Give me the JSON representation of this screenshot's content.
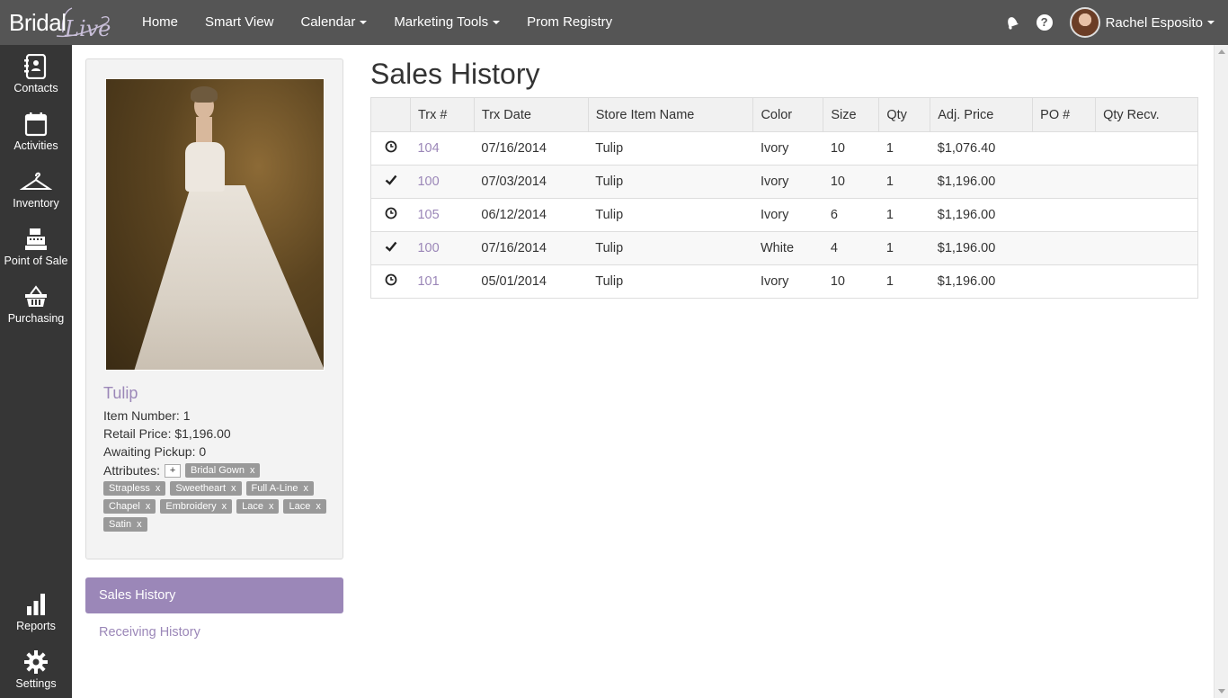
{
  "brand": {
    "part1": "Bridal",
    "part2": "Live"
  },
  "nav": {
    "items": [
      {
        "label": "Home",
        "dropdown": false
      },
      {
        "label": "Smart View",
        "dropdown": false
      },
      {
        "label": "Calendar",
        "dropdown": true
      },
      {
        "label": "Marketing Tools",
        "dropdown": true
      },
      {
        "label": "Prom Registry",
        "dropdown": false
      }
    ],
    "help": "?",
    "user_name": "Rachel Esposito"
  },
  "sidebar": {
    "top_items": [
      {
        "label": "Contacts",
        "icon": "contacts-icon"
      },
      {
        "label": "Activities",
        "icon": "calendar-icon"
      },
      {
        "label": "Inventory",
        "icon": "hanger-icon"
      },
      {
        "label": "Point of Sale",
        "icon": "register-icon"
      },
      {
        "label": "Purchasing",
        "icon": "basket-icon"
      }
    ],
    "bottom_items": [
      {
        "label": "Reports",
        "icon": "bar-chart-icon"
      },
      {
        "label": "Settings",
        "icon": "gear-icon"
      }
    ]
  },
  "product": {
    "name": "Tulip",
    "item_number": "Item Number: 1",
    "retail_price": "Retail Price: $1,196.00",
    "awaiting_pickup": "Awaiting Pickup: 0",
    "attributes_label": "Attributes:",
    "add_attribute": "+",
    "remove_glyph": "x",
    "attributes": [
      "Bridal Gown",
      "Strapless",
      "Sweetheart",
      "Full A-Line",
      "Chapel",
      "Embroidery",
      "Lace",
      "Lace",
      "Satin"
    ]
  },
  "tabs": {
    "active": "Sales History",
    "other": "Receiving History"
  },
  "main": {
    "title": "Sales History",
    "columns": [
      "",
      "Trx #",
      "Trx Date",
      "Store Item Name",
      "Color",
      "Size",
      "Qty",
      "Adj. Price",
      "PO #",
      "Qty Recv."
    ],
    "rows": [
      {
        "status": "pending",
        "trx": "104",
        "date": "07/16/2014",
        "item": "Tulip",
        "color": "Ivory",
        "size": "10",
        "qty": "1",
        "price": "$1,076.40",
        "po": "",
        "qty_recv": ""
      },
      {
        "status": "complete",
        "trx": "100",
        "date": "07/03/2014",
        "item": "Tulip",
        "color": "Ivory",
        "size": "10",
        "qty": "1",
        "price": "$1,196.00",
        "po": "",
        "qty_recv": ""
      },
      {
        "status": "pending",
        "trx": "105",
        "date": "06/12/2014",
        "item": "Tulip",
        "color": "Ivory",
        "size": "6",
        "qty": "1",
        "price": "$1,196.00",
        "po": "",
        "qty_recv": ""
      },
      {
        "status": "complete",
        "trx": "100",
        "date": "07/16/2014",
        "item": "Tulip",
        "color": "White",
        "size": "4",
        "qty": "1",
        "price": "$1,196.00",
        "po": "",
        "qty_recv": ""
      },
      {
        "status": "pending",
        "trx": "101",
        "date": "05/01/2014",
        "item": "Tulip",
        "color": "Ivory",
        "size": "10",
        "qty": "1",
        "price": "$1,196.00",
        "po": "",
        "qty_recv": ""
      }
    ]
  },
  "colors": {
    "accent": "#9b87b8",
    "topbar": "#555555",
    "sidebar": "#363636"
  }
}
